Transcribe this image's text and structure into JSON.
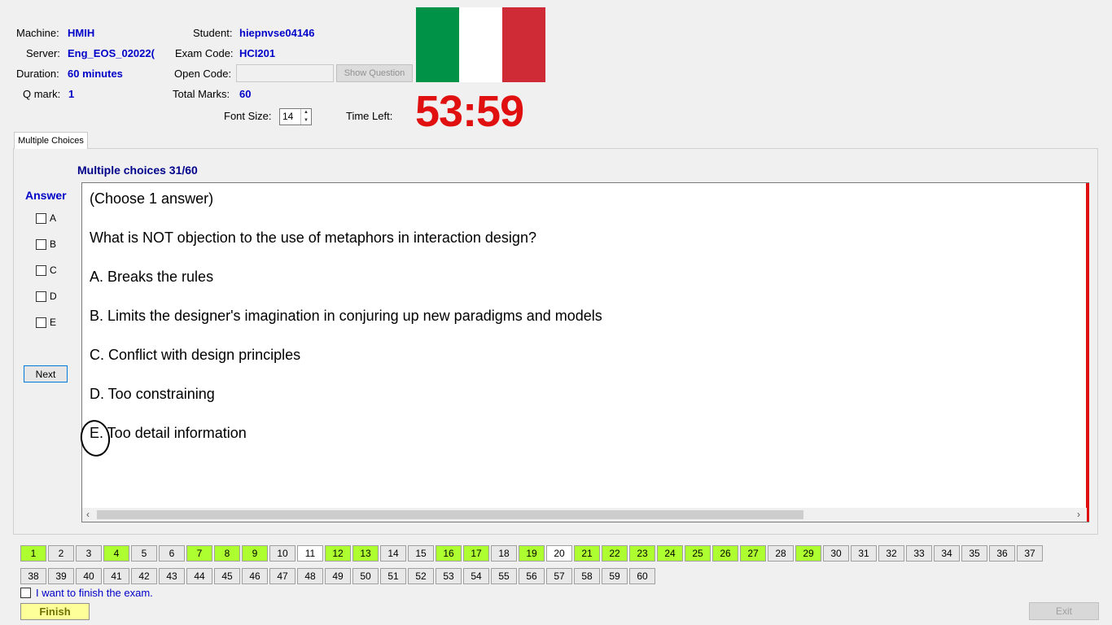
{
  "info": {
    "machine_label": "Machine:",
    "machine_value": "HMIH",
    "server_label": "Server:",
    "server_value": "Eng_EOS_02022(",
    "duration_label": "Duration:",
    "duration_value": "60 minutes",
    "qmark_label": "Q mark:",
    "qmark_value": "1",
    "student_label": "Student:",
    "student_value": "hiepnvse04146",
    "examcode_label": "Exam Code:",
    "examcode_value": "HCI201",
    "opencode_label": "Open Code:",
    "opencode_value": "",
    "show_question_label": "Show Question",
    "totalmarks_label": "Total Marks:",
    "totalmarks_value": "60",
    "fontsize_label": "Font Size:",
    "fontsize_value": "14",
    "timeleft_label": "Time Left:",
    "timeleft_value": "53:59"
  },
  "flag": {
    "colors": [
      "#009246",
      "#ffffff",
      "#ce2b37"
    ]
  },
  "tab": {
    "label": "Multiple Choices"
  },
  "question": {
    "header": "Multiple choices 31/60",
    "instruction": "(Choose 1 answer)",
    "text": "What is NOT objection to the use of metaphors in interaction design?",
    "options": [
      "A.  Breaks the rules",
      "B.  Limits the designer's imagination in conjuring up new paradigms and models",
      "C.  Conflict with design principles",
      "D.  Too constraining",
      "E.  Too detail information"
    ]
  },
  "answer": {
    "title": "Answer",
    "choices": [
      "A",
      "B",
      "C",
      "D",
      "E"
    ],
    "next_label": "Next"
  },
  "nav": {
    "row1": [
      {
        "n": "1",
        "s": "done"
      },
      {
        "n": "2",
        "s": ""
      },
      {
        "n": "3",
        "s": ""
      },
      {
        "n": "4",
        "s": "done"
      },
      {
        "n": "5",
        "s": ""
      },
      {
        "n": "6",
        "s": ""
      },
      {
        "n": "7",
        "s": "done"
      },
      {
        "n": "8",
        "s": "done"
      },
      {
        "n": "9",
        "s": "done"
      },
      {
        "n": "10",
        "s": ""
      },
      {
        "n": "11",
        "s": "cur"
      },
      {
        "n": "12",
        "s": "done"
      },
      {
        "n": "13",
        "s": "done"
      },
      {
        "n": "14",
        "s": ""
      },
      {
        "n": "15",
        "s": ""
      },
      {
        "n": "16",
        "s": "done"
      },
      {
        "n": "17",
        "s": "done"
      },
      {
        "n": "18",
        "s": ""
      },
      {
        "n": "19",
        "s": "done"
      },
      {
        "n": "20",
        "s": "cur"
      },
      {
        "n": "21",
        "s": "done"
      },
      {
        "n": "22",
        "s": "done"
      },
      {
        "n": "23",
        "s": "done"
      },
      {
        "n": "24",
        "s": "done"
      },
      {
        "n": "25",
        "s": "done"
      },
      {
        "n": "26",
        "s": "done"
      },
      {
        "n": "27",
        "s": "done"
      },
      {
        "n": "28",
        "s": ""
      },
      {
        "n": "29",
        "s": "done"
      },
      {
        "n": "30",
        "s": ""
      },
      {
        "n": "31",
        "s": ""
      },
      {
        "n": "32",
        "s": ""
      },
      {
        "n": "33",
        "s": ""
      },
      {
        "n": "34",
        "s": ""
      },
      {
        "n": "35",
        "s": ""
      },
      {
        "n": "36",
        "s": ""
      },
      {
        "n": "37",
        "s": ""
      }
    ],
    "row2": [
      {
        "n": "38",
        "s": ""
      },
      {
        "n": "39",
        "s": ""
      },
      {
        "n": "40",
        "s": ""
      },
      {
        "n": "41",
        "s": ""
      },
      {
        "n": "42",
        "s": ""
      },
      {
        "n": "43",
        "s": ""
      },
      {
        "n": "44",
        "s": ""
      },
      {
        "n": "45",
        "s": ""
      },
      {
        "n": "46",
        "s": ""
      },
      {
        "n": "47",
        "s": ""
      },
      {
        "n": "48",
        "s": ""
      },
      {
        "n": "49",
        "s": ""
      },
      {
        "n": "50",
        "s": ""
      },
      {
        "n": "51",
        "s": ""
      },
      {
        "n": "52",
        "s": ""
      },
      {
        "n": "53",
        "s": ""
      },
      {
        "n": "54",
        "s": ""
      },
      {
        "n": "55",
        "s": ""
      },
      {
        "n": "56",
        "s": ""
      },
      {
        "n": "57",
        "s": ""
      },
      {
        "n": "58",
        "s": ""
      },
      {
        "n": "59",
        "s": ""
      },
      {
        "n": "60",
        "s": ""
      }
    ]
  },
  "footer": {
    "finish_check_label": "I want to finish the exam.",
    "finish_label": "Finish",
    "exit_label": "Exit"
  }
}
